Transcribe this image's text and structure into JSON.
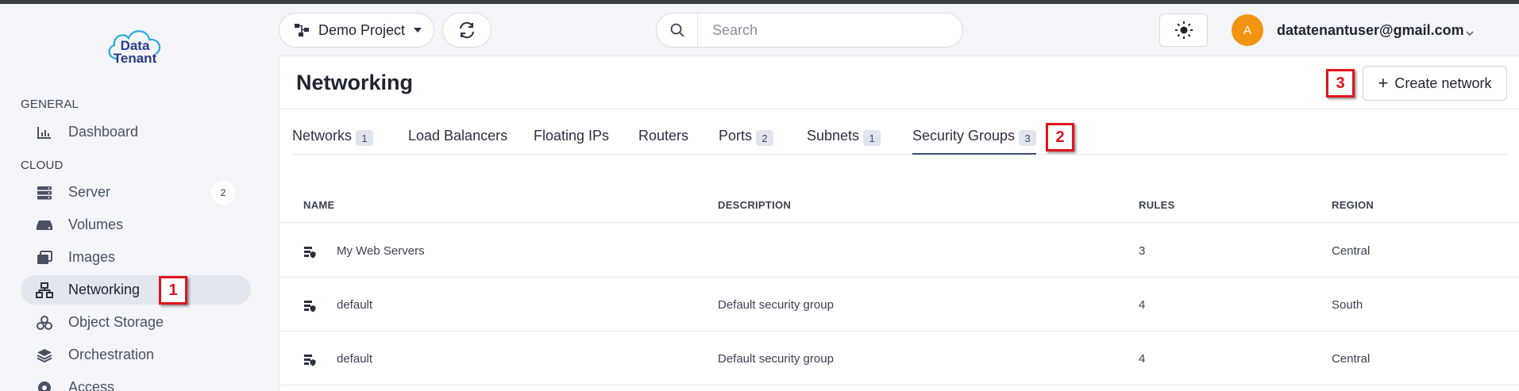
{
  "sidebar": {
    "logo": {
      "line1": "Data",
      "line2": "Tenant"
    },
    "sections": [
      {
        "label": "GENERAL"
      },
      {
        "label": "CLOUD"
      }
    ],
    "items": [
      {
        "label": "Dashboard",
        "icon": "chart-icon"
      },
      {
        "label": "Server",
        "icon": "server-icon",
        "badge": "2"
      },
      {
        "label": "Volumes",
        "icon": "drive-icon"
      },
      {
        "label": "Images",
        "icon": "images-icon"
      },
      {
        "label": "Networking",
        "icon": "network-icon",
        "active": true
      },
      {
        "label": "Object Storage",
        "icon": "boxes-icon"
      },
      {
        "label": "Orchestration",
        "icon": "layers-icon"
      },
      {
        "label": "Access",
        "icon": "access-icon"
      }
    ]
  },
  "markers": [
    "1",
    "2",
    "3"
  ],
  "header": {
    "project": "Demo Project",
    "search_placeholder": "Search",
    "avatar_initial": "A",
    "user_email": "datatenantuser@gmail.com"
  },
  "page": {
    "title": "Networking",
    "create_label": "Create network",
    "tabs": [
      {
        "label": "Networks",
        "count": "1"
      },
      {
        "label": "Load Balancers"
      },
      {
        "label": "Floating IPs"
      },
      {
        "label": "Routers"
      },
      {
        "label": "Ports",
        "count": "2"
      },
      {
        "label": "Subnets",
        "count": "1"
      },
      {
        "label": "Security Groups",
        "count": "3",
        "active": true
      }
    ],
    "table": {
      "columns": [
        "NAME",
        "DESCRIPTION",
        "RULES",
        "REGION"
      ],
      "rows": [
        {
          "name": "My Web Servers",
          "description": "",
          "rules": "3",
          "region": "Central"
        },
        {
          "name": "default",
          "description": "Default security group",
          "rules": "4",
          "region": "South"
        },
        {
          "name": "default",
          "description": "Default security group",
          "rules": "4",
          "region": "Central"
        }
      ]
    }
  },
  "colors": {
    "accent": "#3a4e7a",
    "marker": "#e0141e",
    "avatar": "#f39312"
  }
}
